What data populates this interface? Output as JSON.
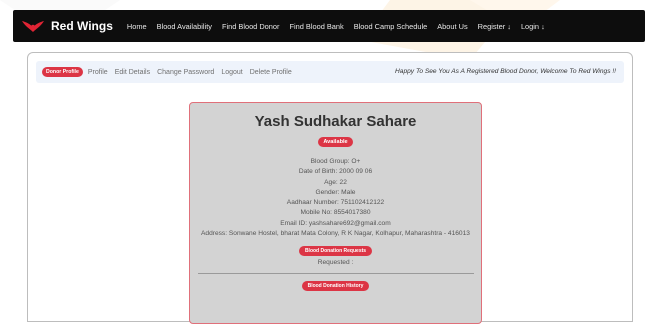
{
  "navbar": {
    "brand": "Red Wings",
    "links": [
      "Home",
      "Blood Availability",
      "Find Blood Donor",
      "Find Blood Bank",
      "Blood Camp Schedule",
      "About Us",
      "Register ↓",
      "Login ↓"
    ]
  },
  "subnav": {
    "badge": "Donor Profile",
    "links": [
      "Profile",
      "Edit Details",
      "Change Password",
      "Logout",
      "Delete Profile"
    ],
    "welcome": "Happy To See You As A Registered Blood Donor, Welcome To Red Wings !!"
  },
  "profile": {
    "name": "Yash Sudhakar Sahare",
    "status": "Available",
    "details": [
      "Blood Group: O+",
      "Date of Birth: 2000 09 06",
      "Age: 22",
      "Gender: Male",
      "Aadhaar Number: 751102412122",
      "Mobile No: 8554017380",
      "Email ID: yashsahare692@gmail.com",
      "Address: Sonwane Hostel, bharat Mata Colony, R K Nagar, Kolhapur, Maharashtra - 416013"
    ],
    "requests_badge": "Blood Donation Requests",
    "requested_text": "Requested :",
    "history_badge": "Blood Donation History"
  },
  "colors": {
    "accent": "#dc3545",
    "navbar": "#0d0d0d",
    "card": "#d3d3d3",
    "subnav": "#eef3fb"
  }
}
